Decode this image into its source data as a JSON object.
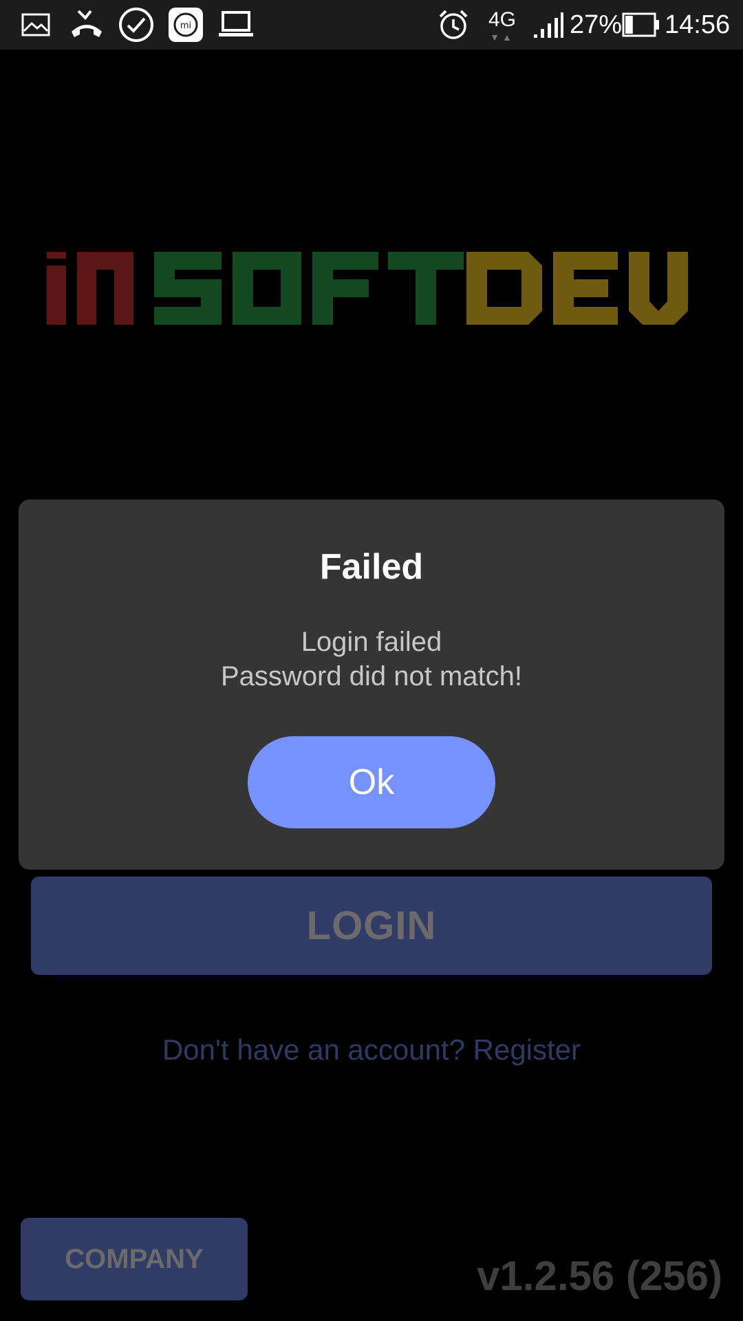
{
  "status_bar": {
    "icons": [
      "gallery-icon",
      "missed-call-icon",
      "check-circle-icon",
      "mi-icon",
      "laptop-icon",
      "alarm-icon",
      "signal-icon",
      "battery-icon"
    ],
    "network": "4G",
    "battery_percent": "27%",
    "battery_level": 0.27,
    "time": "14:56"
  },
  "logo": {
    "text": "INSOFTDEV",
    "colors": {
      "in": "#5c1515",
      "soft": "#134a22",
      "dev": "#6e5a11"
    }
  },
  "dialog": {
    "title": "Failed",
    "message_lines": [
      "Login failed",
      "Password did not match!"
    ],
    "ok_label": "Ok"
  },
  "login": {
    "button_label": "LOGIN",
    "register_text": "Don't have an account? Register"
  },
  "footer": {
    "company_label": "COMPANY",
    "version": "v1.2.56 (256)"
  },
  "colors": {
    "accent": "#7592fd",
    "button_dim": "#303b66",
    "dialog_bg": "#353535",
    "background": "#000000"
  }
}
